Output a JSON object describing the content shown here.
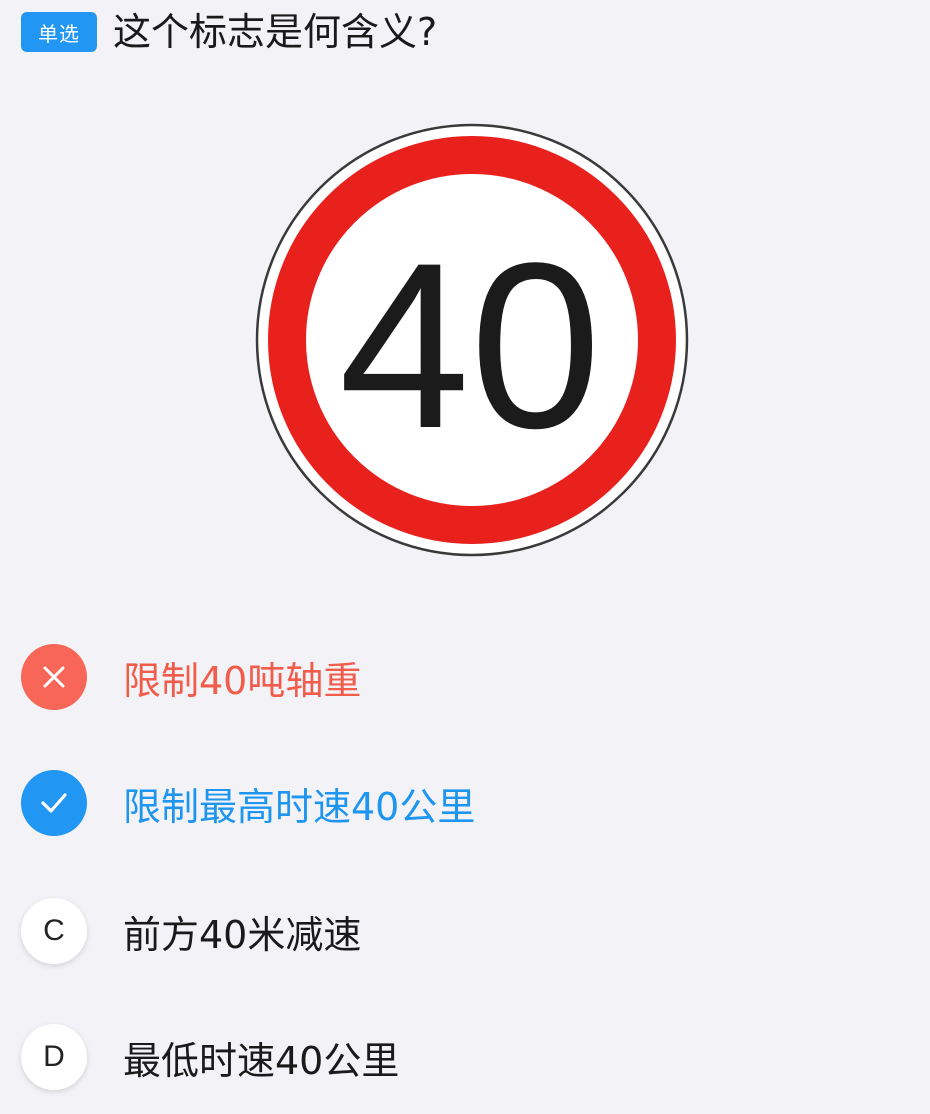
{
  "question": {
    "type_badge": "单选",
    "text": "这个标志是何含义?"
  },
  "sign": {
    "text": "40",
    "ring_color": "#e8211d",
    "text_color": "#1b1b1b"
  },
  "options": [
    {
      "marker": "",
      "text": "限制40吨轴重",
      "state": "wrong",
      "icon": "close-icon"
    },
    {
      "marker": "",
      "text": "限制最高时速40公里",
      "state": "correct",
      "icon": "check-icon"
    },
    {
      "marker": "C",
      "text": "前方40米减速",
      "state": "unselected",
      "icon": ""
    },
    {
      "marker": "D",
      "text": "最低时速40公里",
      "state": "unselected",
      "icon": ""
    }
  ],
  "colors": {
    "accent_blue": "#2196f3",
    "wrong_red": "#f76657",
    "background": "#f3f2f7"
  }
}
